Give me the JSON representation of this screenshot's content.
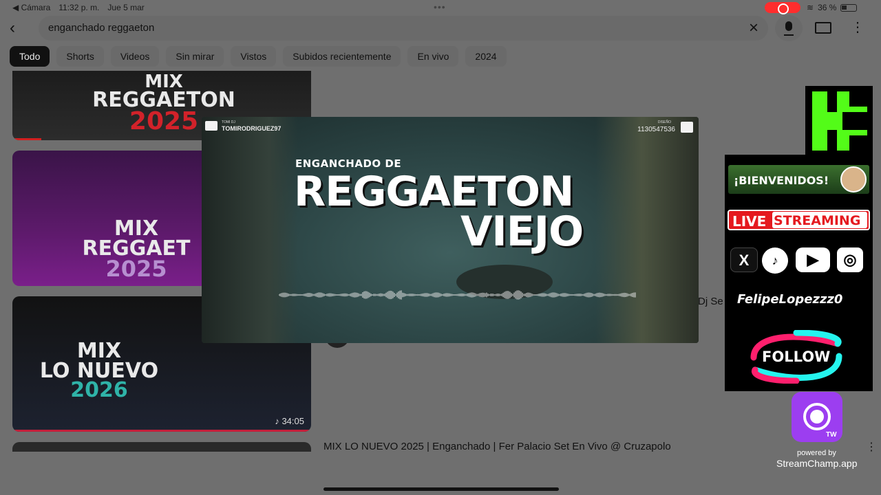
{
  "status_bar": {
    "back_app": "◀ Cámara",
    "time": "11:32 p. m.",
    "date": "Jue 5 mar",
    "battery": "36 %"
  },
  "search": {
    "query": "enganchado reggaeton"
  },
  "chips": [
    "Todo",
    "Shorts",
    "Videos",
    "Sin mirar",
    "Vistos",
    "Subidos recientemente",
    "En vivo",
    "2024"
  ],
  "thumbnails": {
    "t1": {
      "line1": "MIX",
      "line2": "REGGAETON",
      "line3": "2025"
    },
    "t2": {
      "line1": "MIX",
      "line2": "REGGAET",
      "line3": "2025"
    },
    "t3": {
      "line1": "MIX",
      "line2": "LO NUEVO",
      "line3": "2026",
      "duration": "34:05"
    }
  },
  "results": {
    "partial_title": "Dj Se",
    "title_4": "MIX LO NUEVO 2025 | Enganchado | Fer Palacio Set En Vivo @ Cruzapolo"
  },
  "video_overlay": {
    "twitter_label": "TOMI DJ",
    "twitter_handle": "TOMIRODRIGUEZ97",
    "phone_label": "DISEÑO",
    "phone_number": "1130547536",
    "subtitle": "ENGANCHADO DE",
    "title_line1": "REGGAETON",
    "title_line2": "VIEJO"
  },
  "stream_panel": {
    "welcome": "¡BIENVENIDOS!",
    "live_a": "LIVE",
    "live_b": "STREAMING",
    "social": {
      "x": "X",
      "tiktok": "♪",
      "youtube": "▶",
      "instagram": "◎"
    },
    "handle": "FelipeLopezzz0",
    "follow": "FOLLOW"
  },
  "streamchamp": {
    "tag": "TW",
    "powered": "powered by",
    "app": "StreamChamp.app"
  },
  "colors": {
    "chip_active_bg": "#111111",
    "kick_green": "#53fc18",
    "live_red": "#e5191f",
    "twitch_purple": "#9c3ef0"
  }
}
